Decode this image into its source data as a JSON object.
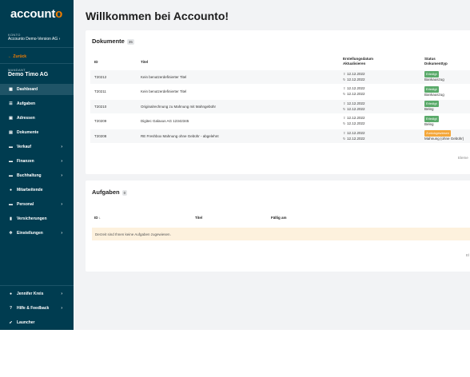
{
  "sidebar": {
    "logo_main": "account",
    "logo_accent": "o",
    "konto_label": "KONTO",
    "company": "Accounto Demo-Version AG",
    "company_chevron": "›",
    "back_label": "Zurück",
    "mandant_label": "MANDANT",
    "user_label": "Demo Timo AG",
    "items": [
      {
        "label": "Dashboard",
        "icon": "dashboard-icon",
        "glyph": "▦",
        "chevron": ""
      },
      {
        "label": "Aufgaben",
        "icon": "list-icon",
        "glyph": "☰",
        "chevron": ""
      },
      {
        "label": "Adressen",
        "icon": "address-book-icon",
        "glyph": "▣",
        "chevron": ""
      },
      {
        "label": "Dokumente",
        "icon": "document-icon",
        "glyph": "▤",
        "chevron": ""
      },
      {
        "label": "Verkauf",
        "icon": "sales-icon",
        "glyph": "▬",
        "chevron": "›"
      },
      {
        "label": "Finanzen",
        "icon": "finance-icon",
        "glyph": "▬",
        "chevron": "›"
      },
      {
        "label": "Buchhaltung",
        "icon": "bookkeeping-icon",
        "glyph": "▬",
        "chevron": "›"
      },
      {
        "label": "Mitarbeitende",
        "icon": "employees-icon",
        "glyph": "●",
        "chevron": ""
      },
      {
        "label": "Personal",
        "icon": "personnel-icon",
        "glyph": "▬",
        "chevron": "›"
      },
      {
        "label": "Versicherungen",
        "icon": "insurance-icon",
        "glyph": "▮",
        "chevron": ""
      },
      {
        "label": "Einstellungen",
        "icon": "settings-icon",
        "glyph": "✲",
        "chevron": "›"
      }
    ],
    "bottom_items": [
      {
        "label": "Jennifer Kreis",
        "icon": "user-icon",
        "glyph": "●",
        "chevron": "›"
      },
      {
        "label": "Hilfe & Feedback",
        "icon": "help-icon",
        "glyph": "?",
        "chevron": "›"
      },
      {
        "label": "Launcher",
        "icon": "rocket-icon",
        "glyph": "➶",
        "chevron": ""
      }
    ]
  },
  "main": {
    "title": "Willkommen bei Accounto!",
    "documents": {
      "title": "Dokumente",
      "count": "35",
      "headers": {
        "id": "ID",
        "title": "Titel",
        "date_line1": "Erstellungsdatum",
        "date_line2": "Aktualisieren",
        "status_line1": "Status",
        "status_line2": "Dokumenttyp"
      },
      "rows": [
        {
          "id": "T20212",
          "title": "Kein benutzerdefinierter Titel",
          "created": "12.12.2022",
          "updated": "12.12.2022",
          "status": "Erledigt",
          "status_color": "green",
          "type": "Bankauszug"
        },
        {
          "id": "T20211",
          "title": "Kein benutzerdefinierter Titel",
          "created": "12.12.2022",
          "updated": "12.12.2022",
          "status": "Erledigt",
          "status_color": "green",
          "type": "Bankauszug"
        },
        {
          "id": "T20210",
          "title": "Originalrechnung zu Mahnung mit Mahngebühr",
          "created": "12.12.2022",
          "updated": "12.12.2022",
          "status": "Erledigt",
          "status_color": "green",
          "type": "Beleg"
        },
        {
          "id": "T20209",
          "title": "Digitec Galaxus AG 12342345",
          "created": "12.12.2022",
          "updated": "12.12.2022",
          "status": "Erledigt",
          "status_color": "green",
          "type": "Beleg"
        },
        {
          "id": "T20208",
          "title": "RE Freshbox Mahnung ohne Gebühr - abgelehnt",
          "created": "12.12.2022",
          "updated": "12.12.2022",
          "status": "Zurückgewiesen",
          "status_color": "orange",
          "type": "Mahnung (ohne Gebühr)"
        }
      ],
      "footer_partial": "Eleme"
    },
    "tasks": {
      "title": "Aufgaben",
      "count": "0",
      "headers": {
        "id": "ID",
        "sort": "↓",
        "title": "Titel",
        "due": "Fällig am"
      },
      "empty_message": "Derzeit sind Ihnen keine Aufgaben zugewiesen.",
      "footer_partial": "El"
    }
  },
  "colors": {
    "sidebar": "#003c50",
    "accent": "#f07d00",
    "success": "#5aaa6a",
    "warning": "#f4a73a"
  }
}
